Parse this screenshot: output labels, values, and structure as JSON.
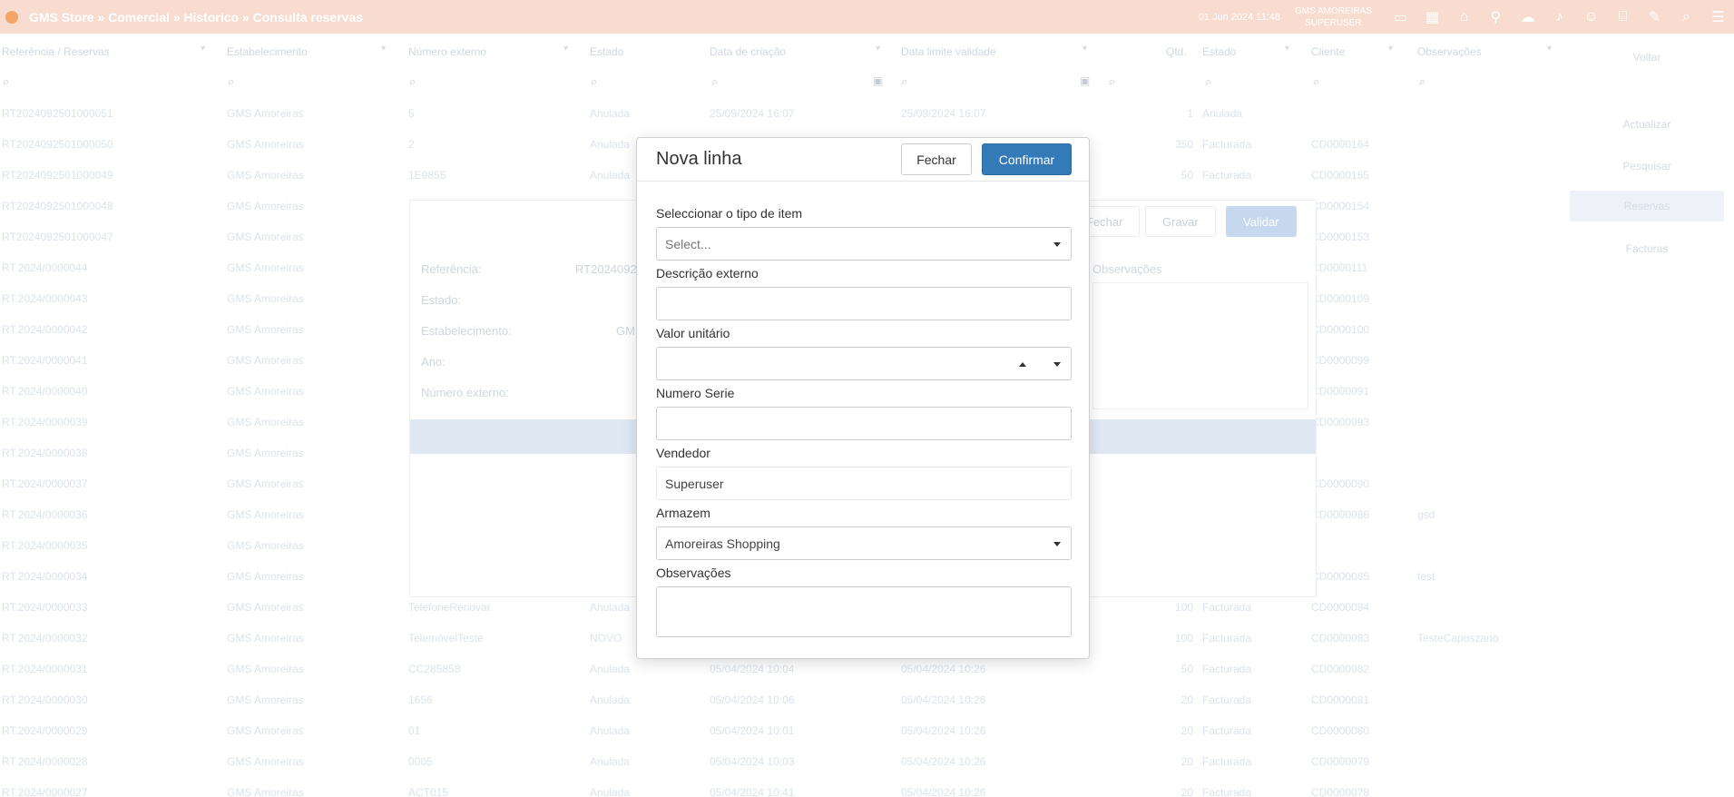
{
  "topbar": {
    "title": "GMS Store » Comercial » Historico » Consulta reservas",
    "clock": "01 Jun 2024 11:48",
    "user_name": "GMS AMOREIRAS",
    "user_role": "SUPERUSER",
    "icons": [
      "monitor-icon",
      "grid-icon",
      "home-icon",
      "pin-icon",
      "chat-icon",
      "bell-icon",
      "user-icon",
      "bank-icon",
      "edit-icon",
      "search-icon",
      "menu-icon"
    ]
  },
  "table": {
    "headers": [
      "Referência / Reservas",
      "Estabelecimento",
      "Número externo",
      "Estado",
      "Data de criação",
      "Data limite validade",
      "Qtd.",
      "Estado",
      "Cliente",
      "Observações"
    ],
    "rows": [
      [
        "RT2024092501000051",
        "GMS Amoreiras",
        "5",
        "Anulada",
        "25/09/2024 16:07",
        "25/09/2024 16:07",
        "1",
        "Anulada",
        "",
        ""
      ],
      [
        "RT2024092501000050",
        "GMS Amoreiras",
        "2",
        "Anulada",
        "",
        "",
        "350",
        "Facturada",
        "CD0000164",
        ""
      ],
      [
        "RT2024092501000049",
        "GMS Amoreiras",
        "1E9855",
        "Anulada",
        "",
        "",
        "50",
        "Facturada",
        "CD0000155",
        ""
      ],
      [
        "RT2024092501000048",
        "GMS Amoreiras",
        "",
        "",
        "",
        "",
        "",
        "",
        "CD0000154",
        ""
      ],
      [
        "RT2024092501000047",
        "GMS Amoreiras",
        "",
        "",
        "",
        "",
        "",
        "",
        "CD0000153",
        ""
      ],
      [
        "RT.2024/0000044",
        "GMS Amoreiras",
        "",
        "",
        "",
        "",
        "",
        "",
        "CD0000111",
        ""
      ],
      [
        "RT.2024/0000043",
        "GMS Amoreiras",
        "",
        "",
        "",
        "",
        "",
        "",
        "CD0000109",
        ""
      ],
      [
        "RT.2024/0000042",
        "GMS Amoreiras",
        "",
        "",
        "",
        "",
        "",
        "",
        "CD0000100",
        ""
      ],
      [
        "RT.2024/0000041",
        "GMS Amoreiras",
        "",
        "",
        "",
        "",
        "",
        "",
        "CD0000099",
        ""
      ],
      [
        "RT.2024/0000040",
        "GMS Amoreiras",
        "",
        "",
        "",
        "",
        "",
        "",
        "CD0000091",
        ""
      ],
      [
        "RT.2024/0000039",
        "GMS Amoreiras",
        "",
        "",
        "",
        "",
        "",
        "",
        "CD0000093",
        ""
      ],
      [
        "RT.2024/0000038",
        "GMS Amoreiras",
        "",
        "",
        "",
        "",
        "",
        "",
        "",
        ""
      ],
      [
        "RT.2024/0000037",
        "GMS Amoreiras",
        "",
        "",
        "",
        "",
        "",
        "",
        "CD0000090",
        ""
      ],
      [
        "RT.2024/0000036",
        "GMS Amoreiras",
        "",
        "",
        "",
        "",
        "",
        "",
        "CD0000088",
        "gsd"
      ],
      [
        "RT.2024/0000035",
        "GMS Amoreiras",
        "",
        "",
        "",
        "",
        "",
        "",
        "",
        ""
      ],
      [
        "RT.2024/0000034",
        "GMS Amoreiras",
        "",
        "",
        "",
        "",
        "",
        "",
        "CD0000085",
        "test"
      ],
      [
        "RT.2024/0000033",
        "GMS Amoreiras",
        "TelefoneRenovar",
        "Anulada",
        "",
        "",
        "100",
        "Facturada",
        "CD0000084",
        ""
      ],
      [
        "RT.2024/0000032",
        "GMS Amoreiras",
        "TelemóvelTeste",
        "NOVO",
        "",
        "",
        "100",
        "Facturada",
        "CD0000083",
        "TesteCaposzano"
      ],
      [
        "RT.2024/0000031",
        "GMS Amoreiras",
        "CC285858",
        "Anulada",
        "05/04/2024 10:04",
        "05/04/2024 10:26",
        "50",
        "Facturada",
        "CD0000082",
        ""
      ],
      [
        "RT.2024/0000030",
        "GMS Amoreiras",
        "1656",
        "Anulada",
        "05/04/2024 10:06",
        "05/04/2024 10:26",
        "20",
        "Facturada",
        "CD0000081",
        ""
      ],
      [
        "RT.2024/0000029",
        "GMS Amoreiras",
        "01",
        "Anulada",
        "05/04/2024 10:01",
        "05/04/2024 10:26",
        "20",
        "Facturada",
        "CD0000080",
        ""
      ],
      [
        "RT.2024/0000028",
        "GMS Amoreiras",
        "0005",
        "Anulada",
        "05/04/2024 10:03",
        "05/04/2024 10:26",
        "20",
        "Facturada",
        "CD0000079",
        ""
      ],
      [
        "RT.2024/0000027",
        "GMS Amoreiras",
        "ACT015",
        "Anulada",
        "05/04/2024 10:41",
        "05/04/2024 10:26",
        "20",
        "Facturada",
        "CD0000078",
        ""
      ]
    ]
  },
  "sidebar": {
    "items": [
      "Voltar",
      "Actualizar",
      "Pesquisar",
      "Reservas",
      "Facturas"
    ]
  },
  "panel": {
    "buttons": [
      "Fechar",
      "Gravar",
      "Validar"
    ],
    "labels": [
      "Referência:",
      "Estado:",
      "Estabelecimento:",
      "Ano:",
      "Número externo:"
    ],
    "values": [
      "RT2024092",
      "",
      "GM",
      "",
      ""
    ],
    "side_label": "Observações"
  },
  "modal": {
    "title": "Nova linha",
    "close_label": "Fechar",
    "confirm_label": "Confirmar",
    "fields": {
      "item_type_label": "Seleccionar o tipo de item",
      "item_type_placeholder": "Select...",
      "desc_label": "Descrição externo",
      "desc_value": "",
      "unit_price_label": "Valor unitário",
      "unit_price_value": "",
      "serial_label": "Numero Serie",
      "serial_value": "",
      "seller_label": "Vendedor",
      "seller_value": "Superuser",
      "warehouse_label": "Armazem",
      "warehouse_value": "Amoreiras Shopping",
      "notes_label": "Observações",
      "notes_value": ""
    }
  }
}
